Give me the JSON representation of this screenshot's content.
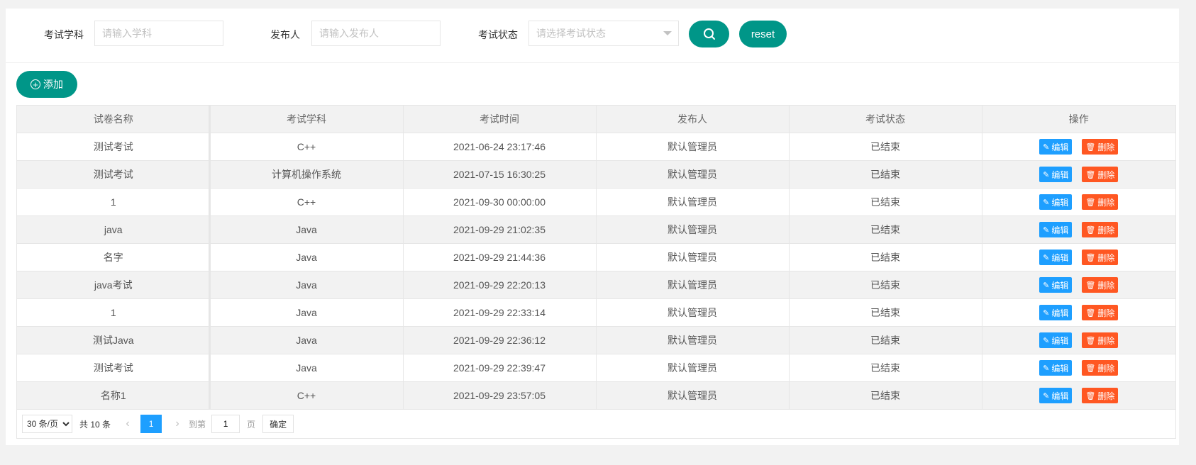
{
  "search": {
    "subject_label": "考试学科",
    "subject_placeholder": "请输入学科",
    "publisher_label": "发布人",
    "publisher_placeholder": "请输入发布人",
    "status_label": "考试状态",
    "status_placeholder": "请选择考试状态",
    "search_icon": "search-icon",
    "reset_label": "reset"
  },
  "toolbar": {
    "add_label": "添加",
    "add_icon": "plus-circle-icon"
  },
  "table": {
    "headers": [
      "试卷名称",
      "考试学科",
      "考试时间",
      "发布人",
      "考试状态",
      "操作"
    ],
    "edit_label": "编辑",
    "delete_label": "删除",
    "rows": [
      [
        "测试考试",
        "C++",
        "2021-06-24 23:17:46",
        "默认管理员",
        "已结束"
      ],
      [
        "测试考试",
        "计算机操作系统",
        "2021-07-15 16:30:25",
        "默认管理员",
        "已结束"
      ],
      [
        "1",
        "C++",
        "2021-09-30 00:00:00",
        "默认管理员",
        "已结束"
      ],
      [
        "java",
        "Java",
        "2021-09-29 21:02:35",
        "默认管理员",
        "已结束"
      ],
      [
        "名字",
        "Java",
        "2021-09-29 21:44:36",
        "默认管理员",
        "已结束"
      ],
      [
        "java考试",
        "Java",
        "2021-09-29 22:20:13",
        "默认管理员",
        "已结束"
      ],
      [
        "1",
        "Java",
        "2021-09-29 22:33:14",
        "默认管理员",
        "已结束"
      ],
      [
        "测试Java",
        "Java",
        "2021-09-29 22:36:12",
        "默认管理员",
        "已结束"
      ],
      [
        "测试考试",
        "Java",
        "2021-09-29 22:39:47",
        "默认管理员",
        "已结束"
      ],
      [
        "名称1",
        "C++",
        "2021-09-29 23:57:05",
        "默认管理员",
        "已结束"
      ]
    ]
  },
  "pagination": {
    "page_size": "30 条/页",
    "total": "共 10 条",
    "current_page": "1",
    "goto_label": "到第",
    "goto_value": "1",
    "page_unit": "页",
    "confirm_label": "确定"
  },
  "colors": {
    "primary": "#009688",
    "edit": "#1e9fff",
    "delete": "#ff5722",
    "page_active": "#1e9fff"
  }
}
